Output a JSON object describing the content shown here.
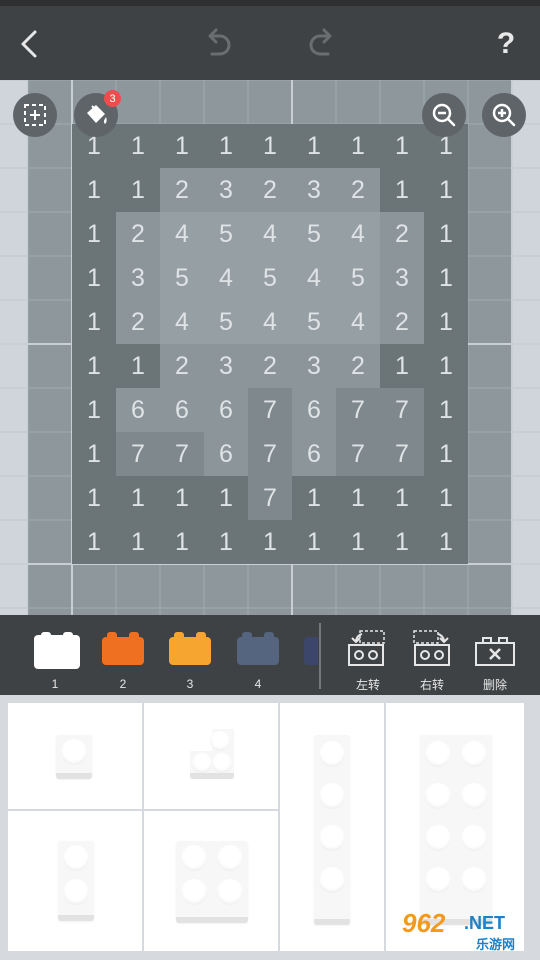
{
  "header": {
    "back_icon": "chevron-left-icon",
    "undo_icon": "undo-icon",
    "redo_icon": "redo-icon",
    "help_label": "?"
  },
  "canvas": {
    "select_icon": "dashed-select-icon",
    "fill_icon": "paint-bucket-icon",
    "fill_badge": "3",
    "zoom_out_icon": "zoom-out-icon",
    "zoom_in_icon": "zoom-in-icon",
    "grid": [
      [
        "1",
        "1",
        "1",
        "1",
        "1",
        "1",
        "1",
        "1",
        "1"
      ],
      [
        "1",
        "1",
        "2",
        "3",
        "2",
        "3",
        "2",
        "1",
        "1"
      ],
      [
        "1",
        "2",
        "4",
        "5",
        "4",
        "5",
        "4",
        "2",
        "1"
      ],
      [
        "1",
        "3",
        "5",
        "4",
        "5",
        "4",
        "5",
        "3",
        "1"
      ],
      [
        "1",
        "2",
        "4",
        "5",
        "4",
        "5",
        "4",
        "2",
        "1"
      ],
      [
        "1",
        "1",
        "2",
        "3",
        "2",
        "3",
        "2",
        "1",
        "1"
      ],
      [
        "1",
        "6",
        "6",
        "6",
        "7",
        "6",
        "7",
        "7",
        "1"
      ],
      [
        "1",
        "7",
        "7",
        "6",
        "7",
        "6",
        "7",
        "7",
        "1"
      ],
      [
        "1",
        "1",
        "1",
        "1",
        "7",
        "1",
        "1",
        "1",
        "1"
      ],
      [
        "1",
        "1",
        "1",
        "1",
        "1",
        "1",
        "1",
        "1",
        "1"
      ]
    ]
  },
  "palette": {
    "colors": [
      {
        "number": "1",
        "color": "#ffffff"
      },
      {
        "number": "2",
        "color": "#f07022"
      },
      {
        "number": "3",
        "color": "#f7a531"
      },
      {
        "number": "4",
        "color": "#55647f"
      }
    ],
    "partial_color": "#3c466a",
    "tools": [
      {
        "label": "左转",
        "icon": "rotate-left-icon"
      },
      {
        "label": "右转",
        "icon": "rotate-right-icon"
      },
      {
        "label": "删除",
        "icon": "delete-brick-icon"
      }
    ]
  },
  "pieces": {
    "items": [
      "brick-1x1",
      "brick-corner",
      "brick-1x2",
      "brick-2x2",
      "brick-1x4",
      "brick-2x4"
    ]
  },
  "watermark": {
    "number": "962",
    "net": ".NET",
    "site": "乐游网"
  }
}
